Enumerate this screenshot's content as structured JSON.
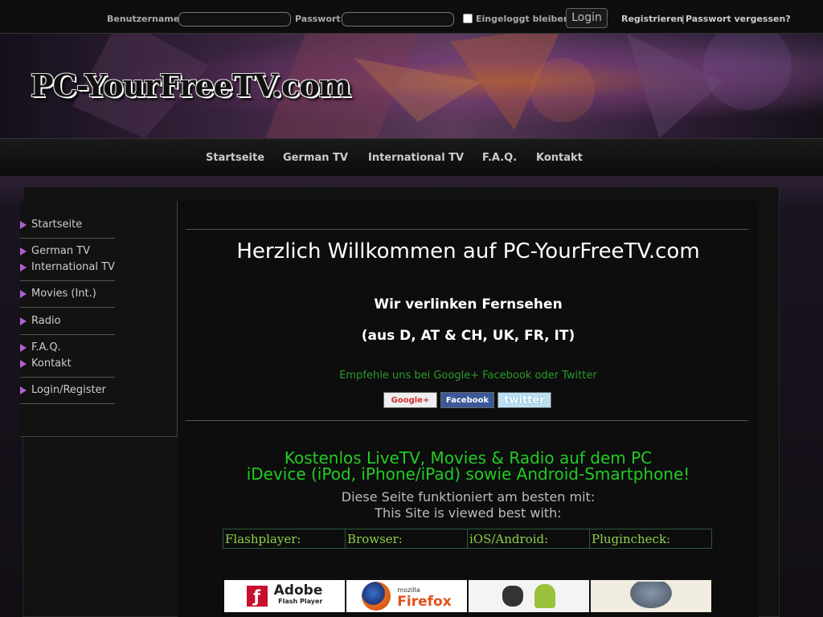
{
  "login": {
    "username_label": "Benutzername",
    "password_label": "Passwort",
    "remember_label": "Eingeloggt bleiben",
    "login_button": "Login",
    "register_link": "Registrieren",
    "separator": "|",
    "forgot_link": "Passwort vergessen?"
  },
  "header": {
    "logo_text": "PC-YourFreeTV.com"
  },
  "nav": {
    "items": [
      "Startseite",
      "German TV",
      "International TV",
      "F.A.Q.",
      "Kontakt"
    ]
  },
  "sidebar": {
    "items": [
      "Startseite",
      "German TV",
      "International TV",
      "Movies (Int.)",
      "Radio",
      "F.A.Q.",
      "Kontakt",
      "Login/Register"
    ]
  },
  "main": {
    "title": "Herzlich Willkommen auf PC-YourFreeTV.com",
    "subtitle1": "Wir verlinken Fernsehen",
    "subtitle2": "(aus D, AT & CH, UK, FR, IT)",
    "recommend": "Empfehle uns bei Google+ Facebook oder Twitter",
    "social": {
      "google": "Google+",
      "facebook": "Facebook",
      "twitter": "twitter"
    },
    "promo1": "Kostenlos LiveTV, Movies & Radio auf dem PC",
    "promo2": "iDevice (iPod, iPhone/iPad) sowie Android-Smartphone!",
    "best1": "Diese Seite funktioniert am besten mit:",
    "best2": "This Site is viewed best with:",
    "table_headers": [
      "Flashplayer:",
      "Browser:",
      "iOS/Android:",
      "Plugincheck:"
    ],
    "tiles": {
      "adobe": "Adobe",
      "adobe_sub": "Flash Player",
      "firefox_small": "mozilla",
      "firefox": "Firefox"
    }
  },
  "colors": {
    "accent_purple": "#b060d0",
    "promo_green": "#22cc22",
    "recommend_green": "#2a9a2a",
    "table_text": "#8fd04a"
  }
}
